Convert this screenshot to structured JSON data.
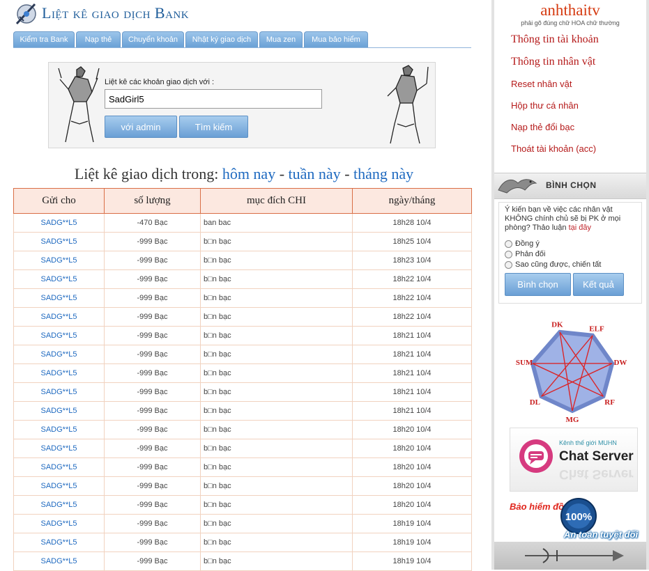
{
  "header": {
    "title": "Liệt kê giao dịch Bank",
    "logo_icon": "sword-emblem-icon"
  },
  "tabs": [
    {
      "label": "Kiểm tra Bank"
    },
    {
      "label": "Nạp thẻ"
    },
    {
      "label": "Chuyển khoản"
    },
    {
      "label": "Nhật ký giao dịch"
    },
    {
      "label": "Mua zen"
    },
    {
      "label": "Mua bảo hiểm"
    }
  ],
  "search": {
    "label": "Liệt kê các khoản giao dịch với :",
    "value": "SadGirl5",
    "btn_admin": "với admin",
    "btn_search": "Tìm kiếm"
  },
  "list": {
    "prefix": "Liệt kê giao dịch trong:",
    "today": "hôm nay",
    "sep1": "-",
    "week": "tuần này",
    "sep2": "-",
    "month": "tháng này"
  },
  "table": {
    "headers": [
      "Gửi cho",
      "số lượng",
      "mục đích CHI",
      "ngày/tháng"
    ],
    "rows": [
      {
        "to": "SADG**L5",
        "amount": "-470  Bạc",
        "purpose": "ban bac",
        "date": "18h28 10/4"
      },
      {
        "to": "SADG**L5",
        "amount": "-999  Bạc",
        "purpose": "b□n bạc",
        "date": "18h25 10/4"
      },
      {
        "to": "SADG**L5",
        "amount": "-999  Bạc",
        "purpose": "b□n bạc",
        "date": "18h23 10/4"
      },
      {
        "to": "SADG**L5",
        "amount": "-999  Bạc",
        "purpose": "b□n bạc",
        "date": "18h22 10/4"
      },
      {
        "to": "SADG**L5",
        "amount": "-999  Bạc",
        "purpose": "b□n bạc",
        "date": "18h22 10/4"
      },
      {
        "to": "SADG**L5",
        "amount": "-999  Bạc",
        "purpose": "b□n bạc",
        "date": "18h22 10/4"
      },
      {
        "to": "SADG**L5",
        "amount": "-999  Bạc",
        "purpose": "b□n bạc",
        "date": "18h21 10/4"
      },
      {
        "to": "SADG**L5",
        "amount": "-999  Bạc",
        "purpose": "b□n bạc",
        "date": "18h21 10/4"
      },
      {
        "to": "SADG**L5",
        "amount": "-999  Bạc",
        "purpose": "b□n bạc",
        "date": "18h21 10/4"
      },
      {
        "to": "SADG**L5",
        "amount": "-999  Bạc",
        "purpose": "b□n bạc",
        "date": "18h21 10/4"
      },
      {
        "to": "SADG**L5",
        "amount": "-999  Bạc",
        "purpose": "b□n bạc",
        "date": "18h21 10/4"
      },
      {
        "to": "SADG**L5",
        "amount": "-999  Bạc",
        "purpose": "b□n bạc",
        "date": "18h20 10/4"
      },
      {
        "to": "SADG**L5",
        "amount": "-999  Bạc",
        "purpose": "b□n bạc",
        "date": "18h20 10/4"
      },
      {
        "to": "SADG**L5",
        "amount": "-999  Bạc",
        "purpose": "b□n bạc",
        "date": "18h20 10/4"
      },
      {
        "to": "SADG**L5",
        "amount": "-999  Bạc",
        "purpose": "b□n bạc",
        "date": "18h20 10/4"
      },
      {
        "to": "SADG**L5",
        "amount": "-999  Bạc",
        "purpose": "b□n bạc",
        "date": "18h20 10/4"
      },
      {
        "to": "SADG**L5",
        "amount": "-999  Bạc",
        "purpose": "b□n bạc",
        "date": "18h19 10/4"
      },
      {
        "to": "SADG**L5",
        "amount": "-999  Bạc",
        "purpose": "b□n bạc",
        "date": "18h19 10/4"
      },
      {
        "to": "SADG**L5",
        "amount": "-999  Bạc",
        "purpose": "b□n bạc",
        "date": "18h19 10/4"
      }
    ]
  },
  "sidebar": {
    "username": "anhthaitv",
    "hint": "phải gõ đúng chữ HOA chữ thường",
    "menu": [
      {
        "label": "Thông tin tài khoản",
        "style": "big"
      },
      {
        "label": "Thông tin nhân vật",
        "style": "big"
      },
      {
        "label": "Reset nhân vật",
        "style": "small"
      },
      {
        "label": "Hộp thư cá nhân",
        "style": "small"
      },
      {
        "label": "Nạp thẻ đổi bạc",
        "style": "small"
      },
      {
        "label": "Thoát tài khoản (acc)",
        "style": "small"
      }
    ],
    "poll": {
      "title": "BÌNH CHỌN",
      "question": "Ý kiến bạn về việc các nhân vật KHÔNG chính chủ sẽ bị PK ở mọi phòng? Thảo luận",
      "link": "tại đây",
      "options": [
        "Đồng ý",
        "Phản đối",
        "Sao cũng được, chiến tất"
      ],
      "vote_label": "Bình chọn",
      "result_label": "Kết quả"
    },
    "classes": [
      "DK",
      "ELF",
      "DW",
      "RF",
      "MG",
      "DL",
      "SUM"
    ],
    "chat": {
      "sub": "Kênh thế giới MUHN",
      "title": "Chat Server"
    },
    "insurance": {
      "title": "Bảo hiểm đồ",
      "badge": "100%",
      "sub": "An toàn tuyệt đối"
    }
  },
  "colors": {
    "accent_blue": "#1f6ac0",
    "menu_red": "#b51a1a",
    "table_border": "#d96e46"
  }
}
